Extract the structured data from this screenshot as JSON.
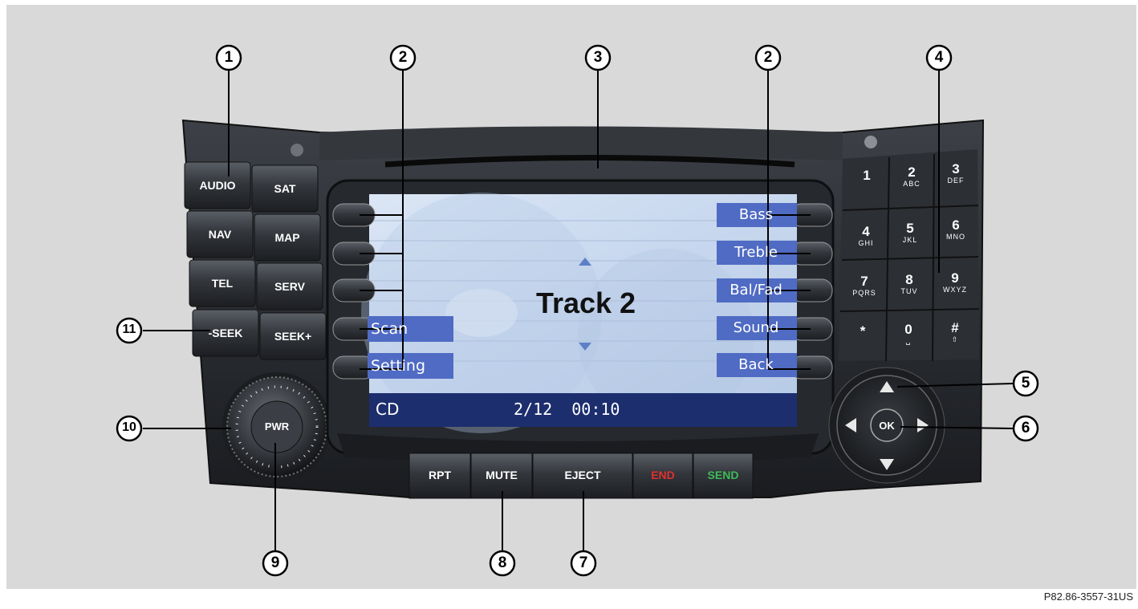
{
  "callouts": {
    "c1": "1",
    "c2": "2",
    "c3": "3",
    "c4": "4",
    "c5": "5",
    "c6": "6",
    "c7": "7",
    "c8": "8",
    "c9": "9",
    "c10": "10",
    "c11": "11"
  },
  "left_buttons": {
    "audio": "AUDIO",
    "sat": "SAT",
    "nav": "NAV",
    "map": "MAP",
    "tel": "TEL",
    "serv": "SERV",
    "seek_minus": "-SEEK",
    "seek_plus": "SEEK+"
  },
  "knob": {
    "label": "PWR"
  },
  "screen": {
    "track": "Track 2",
    "source": "CD",
    "progress": "2/12  00:10",
    "left_soft": {
      "scan": "Scan",
      "setting": "Setting"
    },
    "right_soft": {
      "bass": "Bass",
      "treble": "Treble",
      "balfad": "Bal/Fad",
      "sound": "Sound",
      "back": "Back"
    }
  },
  "bottom_buttons": {
    "rpt": "RPT",
    "mute": "MUTE",
    "eject": "EJECT",
    "end": "END",
    "send": "SEND"
  },
  "keypad": [
    {
      "n": "1",
      "l": ""
    },
    {
      "n": "2",
      "l": "ABC"
    },
    {
      "n": "3",
      "l": "DEF"
    },
    {
      "n": "4",
      "l": "GHI"
    },
    {
      "n": "5",
      "l": "JKL"
    },
    {
      "n": "6",
      "l": "MNO"
    },
    {
      "n": "7",
      "l": "PQRS"
    },
    {
      "n": "8",
      "l": "TUV"
    },
    {
      "n": "9",
      "l": "WXYZ"
    },
    {
      "n": "*",
      "l": ""
    },
    {
      "n": "0",
      "l": "␣"
    },
    {
      "n": "#",
      "l": "⇧"
    }
  ],
  "joystick": {
    "ok": "OK"
  },
  "reference_code": "P82.86-3557-31US",
  "colors": {
    "end": "#e03030",
    "send": "#3dbb5a",
    "screen_bar": "#1c2e6e",
    "softkey": "#4f6bc4"
  }
}
